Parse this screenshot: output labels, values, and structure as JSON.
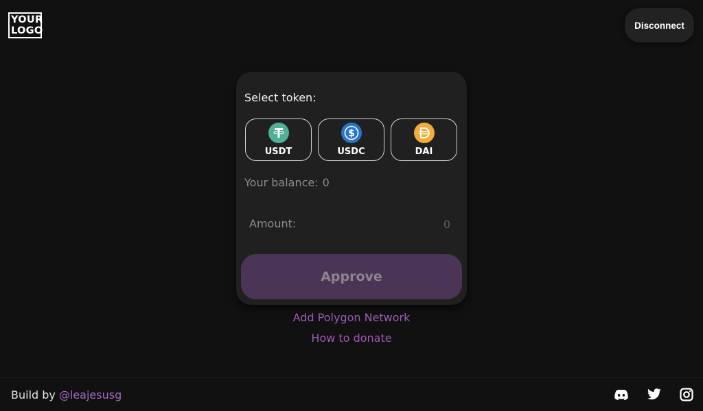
{
  "logo": {
    "line1": "YOUR",
    "line2": "LOGO"
  },
  "header": {
    "disconnect_label": "Disconnect"
  },
  "card": {
    "select_label": "Select token:",
    "tokens": [
      {
        "label": "USDT",
        "icon": "tether-icon",
        "color": "#50AF95"
      },
      {
        "label": "USDC",
        "icon": "usdc-icon",
        "color": "#2775CA"
      },
      {
        "label": "DAI",
        "icon": "dai-icon",
        "color": "#F5AC37"
      }
    ],
    "balance_label": "Your balance:",
    "balance_value": "0",
    "amount_label": "Amount:",
    "amount_placeholder": "0",
    "approve_label": "Approve"
  },
  "links": {
    "add_network": "Add Polygon Network",
    "how_to_donate": "How to donate"
  },
  "footer": {
    "build_prefix": "Build by",
    "build_handle": "@leajesusg",
    "social_icons": [
      "discord-icon",
      "twitter-icon",
      "instagram-icon"
    ]
  },
  "colors": {
    "background": "#121112",
    "card": "#212021",
    "accent": "#9a5bb4",
    "approve_bg": "#4b3556"
  }
}
